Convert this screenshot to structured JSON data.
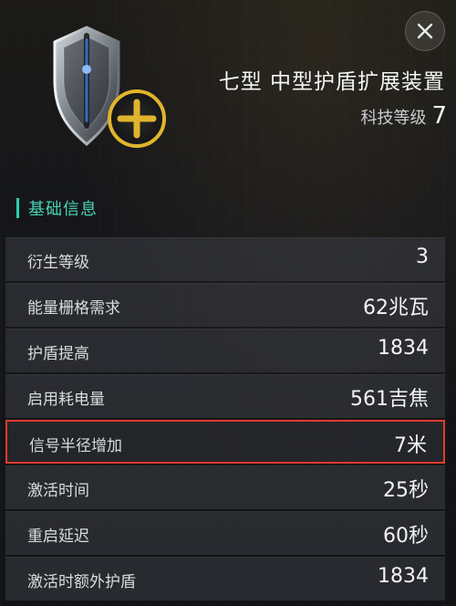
{
  "header": {
    "title": "七型 中型护盾扩展装置",
    "tech_level_label": "科技等级",
    "tech_level_value": "7"
  },
  "section": {
    "title": "基础信息"
  },
  "stats": [
    {
      "label": "衍生等级",
      "value": "3"
    },
    {
      "label": "能量栅格需求",
      "value": "62兆瓦"
    },
    {
      "label": "护盾提高",
      "value": "1834"
    },
    {
      "label": "启用耗电量",
      "value": "561吉焦"
    },
    {
      "label": "信号半径增加",
      "value": "7米"
    },
    {
      "label": "激活时间",
      "value": "25秒"
    },
    {
      "label": "重启延迟",
      "value": "60秒"
    },
    {
      "label": "激活时额外护盾",
      "value": "1834"
    }
  ],
  "icons": {
    "close": "close-icon",
    "item": "shield-extender-icon",
    "plus": "plus-icon"
  },
  "colors": {
    "accent": "#2ad0b0",
    "highlight_border": "#e23b2e",
    "plus_ring": "#e0b52c"
  }
}
